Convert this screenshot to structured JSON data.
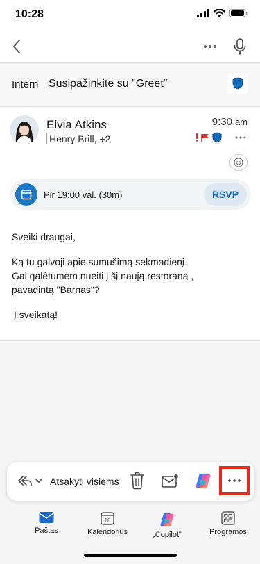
{
  "status_bar": {
    "time": "10:28"
  },
  "email": {
    "label": "Intern",
    "subject": "Susipažinkite su \"Greet\"",
    "sender": "Elvia Atkins",
    "recipients": "Henry Brill, +2",
    "time": "9:30",
    "ampm": "am",
    "event": {
      "text": "Pir 19:00 val. (30m)",
      "rsvp": "RSVP"
    },
    "body": {
      "greeting": "Sveiki draugai,",
      "line1": "Ką tu galvoji apie sumušimą sekmadienį.",
      "line2": "Gal galėtumėm nueiti į šį naują restoraną ,",
      "line3": "pavadintą \"Barnas\"?",
      "closing": "Į sveikatą!"
    }
  },
  "action_bar": {
    "reply_all": "Atsakyti visiems"
  },
  "tabs": [
    {
      "label": "Paštas",
      "icon": "mail-icon"
    },
    {
      "label": "Kalendorius",
      "icon": "calendar-icon",
      "day": "18"
    },
    {
      "label": "„Copilot\"",
      "icon": "copilot-icon"
    },
    {
      "label": "Programos",
      "icon": "apps-icon"
    }
  ],
  "colors": {
    "accent": "#1d78c8",
    "flag_red": "#d13438",
    "highlight": "#e8281c",
    "shield": "#0f6cbd"
  }
}
